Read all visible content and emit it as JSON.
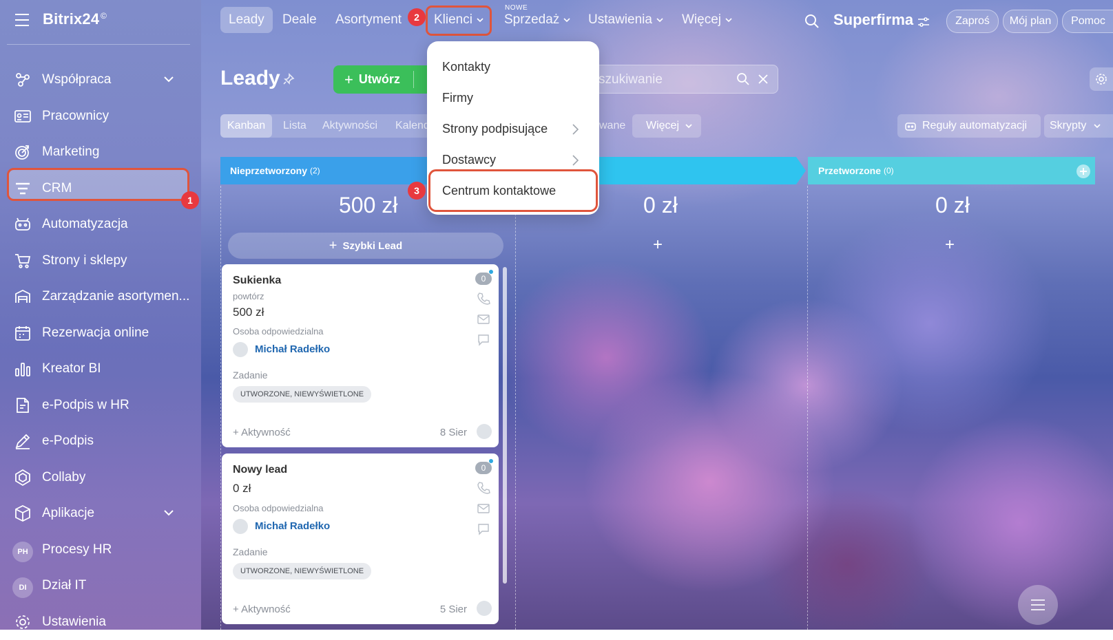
{
  "brand": {
    "name": "Bitrix24",
    "mark": "©"
  },
  "sidebar": {
    "items": [
      {
        "label": "Współpraca",
        "icon": "chat-cloud-icon",
        "chevron": true
      },
      {
        "label": "Pracownicy",
        "icon": "id-card-icon",
        "chevron": false
      },
      {
        "label": "Marketing",
        "icon": "target-icon",
        "chevron": false
      },
      {
        "label": "CRM",
        "icon": "filter-icon",
        "chevron": false
      },
      {
        "label": "Automatyzacja",
        "icon": "robot-icon",
        "chevron": false
      },
      {
        "label": "Strony i sklepy",
        "icon": "cart-icon",
        "chevron": false
      },
      {
        "label": "Zarządzanie asortymen...",
        "icon": "warehouse-icon",
        "chevron": false
      },
      {
        "label": "Rezerwacja online",
        "icon": "calendar-icon",
        "chevron": false
      },
      {
        "label": "Kreator BI",
        "icon": "bar-chart-icon",
        "chevron": false
      },
      {
        "label": "e-Podpis w HR",
        "icon": "document-sign-icon",
        "chevron": false
      },
      {
        "label": "e-Podpis",
        "icon": "pen-icon",
        "chevron": false
      },
      {
        "label": "Collaby",
        "icon": "hexagon-icon",
        "chevron": false
      },
      {
        "label": "Aplikacje",
        "icon": "cube-icon",
        "chevron": true
      },
      {
        "label": "Procesy HR",
        "avatar": "PH",
        "chevron": false
      },
      {
        "label": "Dział IT",
        "avatar": "DI",
        "chevron": false
      },
      {
        "label": "Ustawienia",
        "icon": "gear-icon",
        "chevron": false
      }
    ]
  },
  "top_tabs": [
    {
      "label": "Leady",
      "active": true
    },
    {
      "label": "Deale"
    },
    {
      "label": "Asortyment"
    },
    {
      "label": "Klienci",
      "dropdown": true
    },
    {
      "label": "Sprzedaż",
      "dropdown": true,
      "badge": "NOWE"
    },
    {
      "label": "Ustawienia",
      "dropdown": true
    },
    {
      "label": "Więcej",
      "dropdown": true
    }
  ],
  "header_right": {
    "company": "Superfirma",
    "invite": "Zaproś",
    "plan": "Mój plan",
    "help": "Pomoc"
  },
  "markers": [
    "1",
    "2",
    "3"
  ],
  "page": {
    "title": "Leady",
    "create_label": "Utwórz",
    "search_placeholder": "szukiwanie",
    "views": [
      "Kanban",
      "Lista",
      "Aktywności",
      "Kalend"
    ],
    "views_hidden_tail": "wane",
    "more_views": "Więcej",
    "automation_rules": "Reguły automatyzacji",
    "scripts": "Skrypty"
  },
  "columns": [
    {
      "name": "Nieprzetworzony",
      "count": "(2)",
      "sum": "500 zł",
      "color": "#3aa0ea"
    },
    {
      "name": "",
      "count": "",
      "sum": "0 zł",
      "color": "#2fc4ef"
    },
    {
      "name": "Przetworzone",
      "count": "(0)",
      "sum": "0 zł",
      "color": "#55cfe0"
    }
  ],
  "quick_lead": "Szybki Lead",
  "cards": [
    {
      "title": "Sukienka",
      "subtitle": "powtórz",
      "amount": "500 zł",
      "responsible_label": "Osoba odpowiedzialna",
      "responsible": "Michał Radełko",
      "task_label": "Zadanie",
      "tag": "UTWORZONE, NIEWYŚWIETLONE",
      "activity": "+ Aktywność",
      "date": "8 Sier",
      "counter": "0"
    },
    {
      "title": "Nowy lead",
      "subtitle": "",
      "amount": "0 zł",
      "responsible_label": "Osoba odpowiedzialna",
      "responsible": "Michał Radełko",
      "task_label": "Zadanie",
      "tag": "UTWORZONE, NIEWYŚWIETLONE",
      "activity": "+ Aktywność",
      "date": "5 Sier",
      "counter": "0"
    }
  ],
  "dropdown": {
    "items": [
      {
        "label": "Kontakty",
        "submenu": false
      },
      {
        "label": "Firmy",
        "submenu": false
      },
      {
        "label": "Strony podpisujące",
        "submenu": true
      },
      {
        "label": "Dostawcy",
        "submenu": true
      },
      {
        "label": "Centrum kontaktowe",
        "submenu": false,
        "highlighted": true
      }
    ]
  },
  "colors": {
    "accent_green": "#3bbf5a",
    "highlight": "#e0553c",
    "badge_red": "#e8393f",
    "link_blue": "#2067b0"
  }
}
